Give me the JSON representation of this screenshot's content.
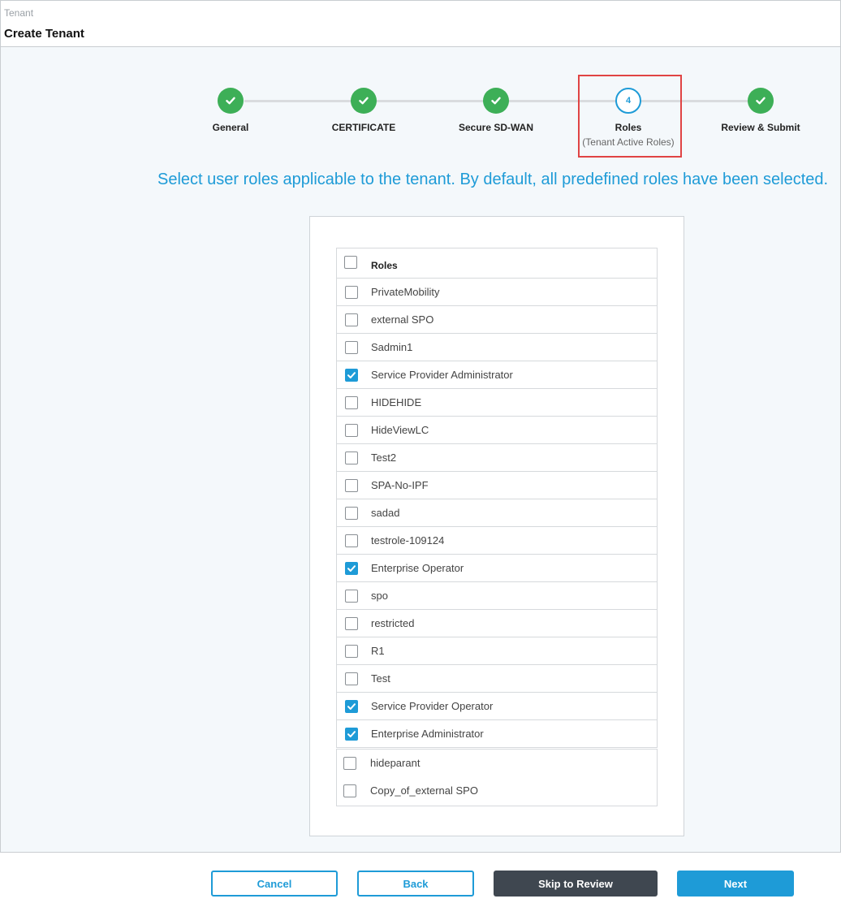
{
  "header": {
    "breadcrumb": "Tenant",
    "title": "Create Tenant"
  },
  "steps": [
    {
      "label": "General",
      "status": "done"
    },
    {
      "label": "CERTIFICATE",
      "status": "done"
    },
    {
      "label": "Secure SD-WAN",
      "status": "done"
    },
    {
      "label": "Roles",
      "sublabel": "(Tenant Active Roles)",
      "number": "4",
      "status": "active"
    },
    {
      "label": "Review & Submit",
      "status": "done"
    }
  ],
  "instruction": "Select user roles applicable to the tenant. By default, all predefined roles have been selected.",
  "table": {
    "header": "Roles",
    "roles": [
      {
        "name": "PrivateMobility",
        "checked": false
      },
      {
        "name": "external SPO",
        "checked": false
      },
      {
        "name": "Sadmin1",
        "checked": false
      },
      {
        "name": "Service Provider Administrator",
        "checked": true
      },
      {
        "name": "HIDEHIDE",
        "checked": false
      },
      {
        "name": "HideViewLC",
        "checked": false
      },
      {
        "name": "Test2",
        "checked": false
      },
      {
        "name": "SPA-No-IPF",
        "checked": false
      },
      {
        "name": "sadad",
        "checked": false
      },
      {
        "name": "testrole-109124",
        "checked": false
      },
      {
        "name": "Enterprise Operator",
        "checked": true
      },
      {
        "name": "spo",
        "checked": false
      },
      {
        "name": "restricted",
        "checked": false
      },
      {
        "name": "R1",
        "checked": false
      },
      {
        "name": "Test",
        "checked": false
      },
      {
        "name": "Service Provider Operator",
        "checked": true
      },
      {
        "name": "Enterprise Administrator",
        "checked": true
      },
      {
        "name": "hideparant",
        "checked": false
      },
      {
        "name": "Copy_of_external SPO",
        "checked": false
      }
    ]
  },
  "buttons": {
    "cancel": "Cancel",
    "back": "Back",
    "skip": "Skip to Review",
    "next": "Next"
  },
  "colors": {
    "accent": "#1e9bd7",
    "success": "#3daf57",
    "highlight": "#e04444",
    "dark_button": "#3f4750"
  }
}
